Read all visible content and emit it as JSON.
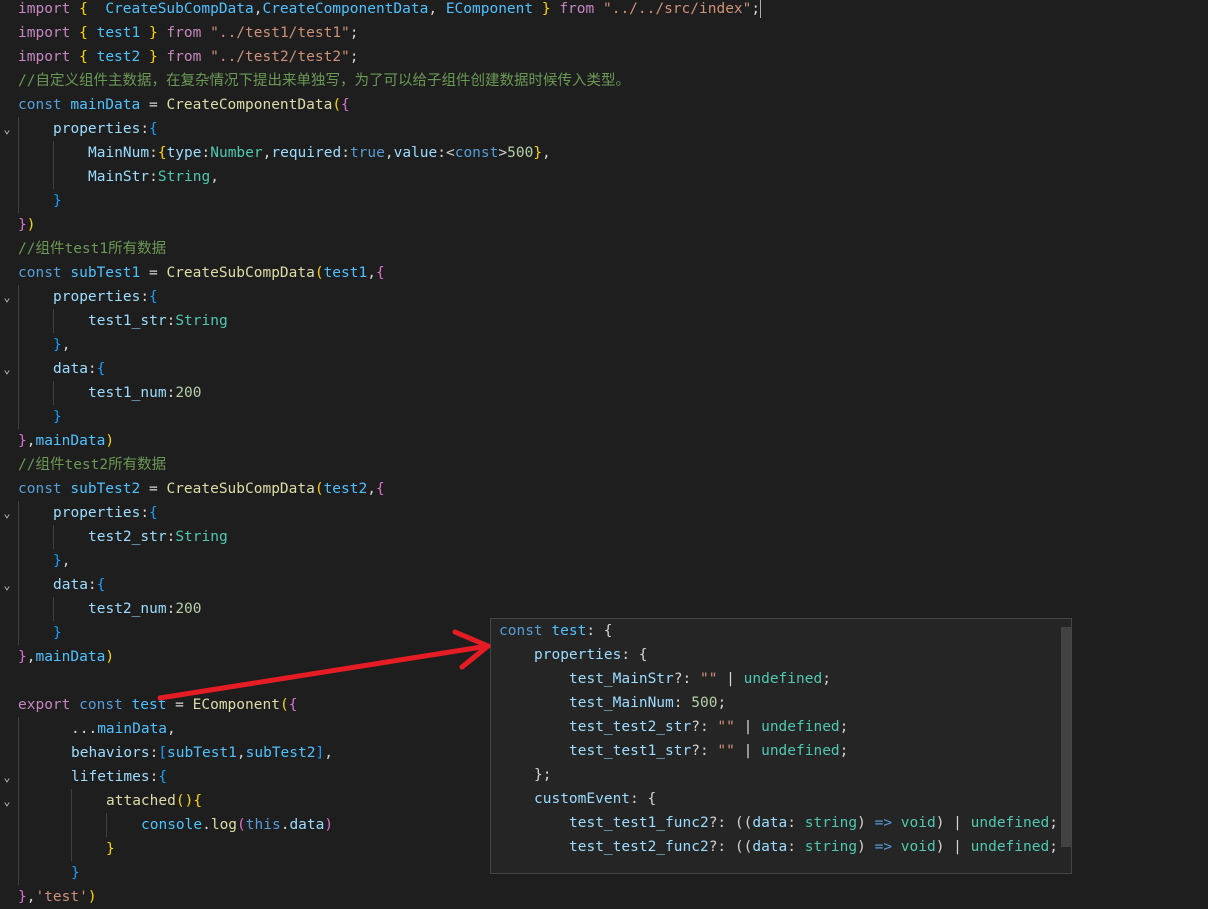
{
  "editor": {
    "lines": [
      "import {  CreateSubCompData,CreateComponentData, EComponent } from \"../../src/index\";",
      "import { test1 } from \"../test1/test1\";",
      "import { test2 } from \"../test2/test2\";",
      "//自定义组件主数据，在复杂情况下提出来单独写，为了可以给子组件创建数据时候传入类型。",
      "const mainData = CreateComponentData({",
      "properties:{",
      "MainNum:{type:Number,required:true,value:<const>500},",
      "MainStr:String,",
      "}",
      "})",
      "//组件test1所有数据",
      "const subTest1 = CreateSubCompData(test1,{",
      "properties:{",
      "test1_str:String",
      "},",
      "data:{",
      "test1_num:200",
      "}",
      "},mainData)",
      "//组件test2所有数据",
      "const subTest2 = CreateSubCompData(test2,{",
      "properties:{",
      "test2_str:String",
      "},",
      "data:{",
      "test2_num:200",
      "}",
      "},mainData)",
      "",
      "export const test = EComponent({",
      "...mainData,",
      "behaviors:[subTest1,subTest2],",
      "lifetimes:{",
      "attached(){",
      "console.log(this.data)",
      "}",
      "}",
      "},'test')"
    ]
  },
  "hover": {
    "lines": [
      "const test: {",
      "properties: {",
      "test_MainStr?: \"\" | undefined;",
      "test_MainNum: 500;",
      "test_test2_str?: \"\" | undefined;",
      "test_test1_str?: \"\" | undefined;",
      "};",
      "customEvent: {",
      "test_test1_func2?: ((data: string) => void) | undefined;",
      "test_test2_func2?: ((data: string) => void) | undefined;"
    ]
  },
  "colors": {
    "background": "#1e1e1e",
    "hover_background": "#252526",
    "keyword": "#c586c0",
    "string": "#ce9178",
    "comment": "#6a9955",
    "arrow": "#e51c23"
  },
  "icons": {
    "fold": "chevron-down-icon"
  }
}
